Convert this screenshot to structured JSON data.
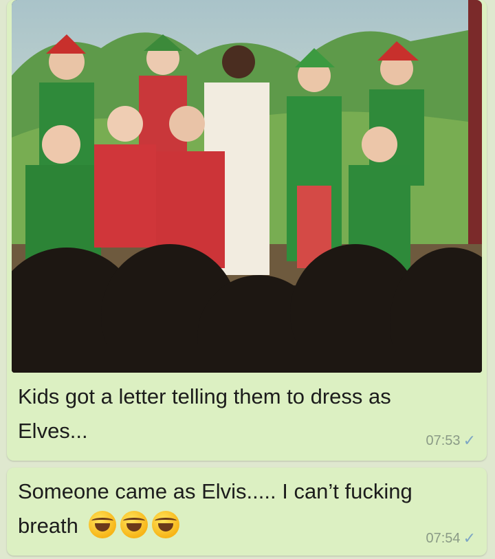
{
  "messages": [
    {
      "text": "Kids got a letter telling them to dress as Elves...",
      "time": "07:53",
      "status_icon": "single-check-icon"
    },
    {
      "text": "Someone came as Elvis..... I can’t fucking breath",
      "emojis": [
        "laughing-tears-emoji",
        "laughing-tears-emoji",
        "laughing-tears-emoji"
      ],
      "time": "07:54",
      "status_icon": "single-check-icon"
    }
  ],
  "colors": {
    "chat_background": "#dfe8cf",
    "bubble": "#dcf0c2",
    "timestamp": "#8a9a86",
    "check": "#7ea6c4"
  }
}
